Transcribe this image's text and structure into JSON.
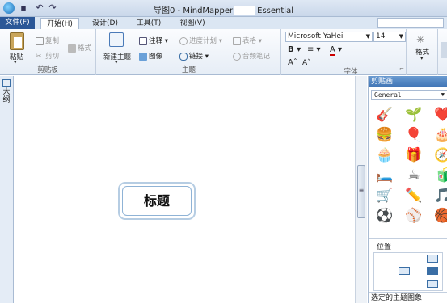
{
  "window": {
    "title_prefix": "导图0 - MindMapper",
    "title_suffix": "Essential"
  },
  "tabs": [
    "文件(F)",
    "开始(H)",
    "设计(D)",
    "工具(T)",
    "视图(V)"
  ],
  "ribbon": {
    "clipboard": {
      "paste": "粘贴",
      "copy": "复制",
      "cut": "剪切",
      "format": "格式",
      "label": "剪贴板"
    },
    "topic": {
      "new_topic": "新建主题",
      "note": "注释",
      "image": "图像",
      "progress": "进度计划",
      "link": "链接",
      "table": "表格",
      "voice_note": "音频笔记",
      "label": "主题"
    },
    "font": {
      "family": "Microsoft YaHei",
      "size": "14",
      "label": "字体"
    },
    "style": {
      "label": "格式"
    }
  },
  "left_strip": {
    "outline_label": "大纲"
  },
  "canvas": {
    "central_topic": "标题"
  },
  "clipart_panel": {
    "title": "剪贴画",
    "category": "General",
    "items": [
      "🎸",
      "🌱",
      "❤️",
      "🍔",
      "🎈",
      "🎂",
      "🧁",
      "🎁",
      "🧭",
      "🛏️",
      "☕",
      "🧃",
      "🛒",
      "✏️",
      "🎵",
      "⚽",
      "⚾",
      "🏀"
    ]
  },
  "position_panel": {
    "label": "位置",
    "footer": "选定的主题图象"
  },
  "colors": {
    "file_tab": "#2b5797",
    "panel_header": "#3f74b5",
    "topic_border": "#8fb3d6"
  }
}
